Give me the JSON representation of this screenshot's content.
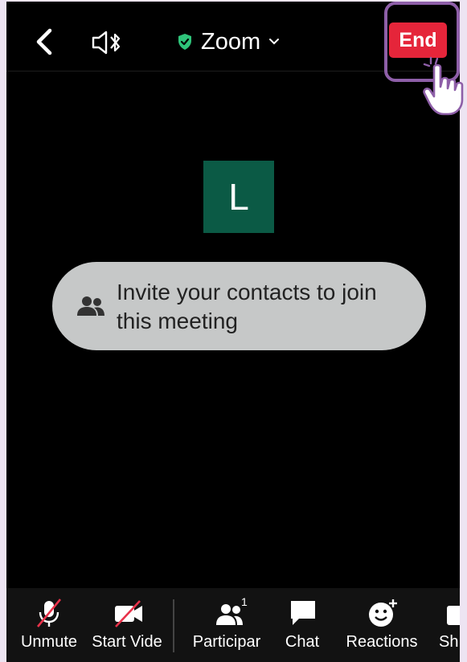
{
  "header": {
    "title": "Zoom",
    "end_label": "End"
  },
  "participant": {
    "initial": "L"
  },
  "invite": {
    "text": "Invite your contacts to join this meeting"
  },
  "toolbar": {
    "items": [
      {
        "label": "Unmute",
        "icon": "microphone-off-icon"
      },
      {
        "label": "Start Vide",
        "icon": "video-off-icon"
      },
      {
        "label": "Participar",
        "icon": "participants-icon",
        "count": "1"
      },
      {
        "label": "Chat",
        "icon": "chat-icon"
      },
      {
        "label": "Reactions",
        "icon": "reactions-icon"
      },
      {
        "label": "Sh",
        "icon": "share-icon"
      }
    ]
  },
  "colors": {
    "end_button": "#e5253a",
    "avatar_bg": "#0b5a45",
    "shield": "#2fc47a",
    "highlight": "#8e5fa8"
  }
}
